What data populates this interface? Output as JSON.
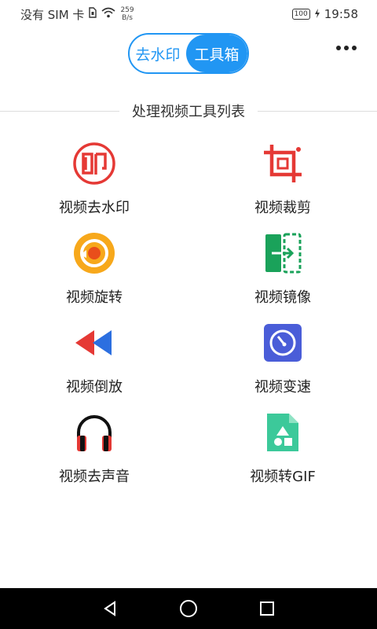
{
  "status_bar": {
    "carrier": "没有 SIM 卡",
    "speed_value": "259",
    "speed_unit": "B/s",
    "battery": "100",
    "time": "19:58"
  },
  "header": {
    "tab_watermark": "去水印",
    "tab_toolbox": "工具箱"
  },
  "section_title": "处理视频工具列表",
  "tools": [
    {
      "label": "视频去水印",
      "icon": "watermark-stamp-icon"
    },
    {
      "label": "视频裁剪",
      "icon": "crop-icon"
    },
    {
      "label": "视频旋转",
      "icon": "rotate-icon"
    },
    {
      "label": "视频镜像",
      "icon": "mirror-icon"
    },
    {
      "label": "视频倒放",
      "icon": "rewind-icon"
    },
    {
      "label": "视频变速",
      "icon": "speedometer-icon"
    },
    {
      "label": "视频去声音",
      "icon": "headphones-icon"
    },
    {
      "label": "视频转GIF",
      "icon": "gif-file-icon"
    }
  ],
  "colors": {
    "accent": "#2196f3",
    "red": "#e53935",
    "orange": "#f7a81b",
    "green": "#1aa25a",
    "indigo": "#4a5dd8",
    "teal": "#3cc99a"
  }
}
